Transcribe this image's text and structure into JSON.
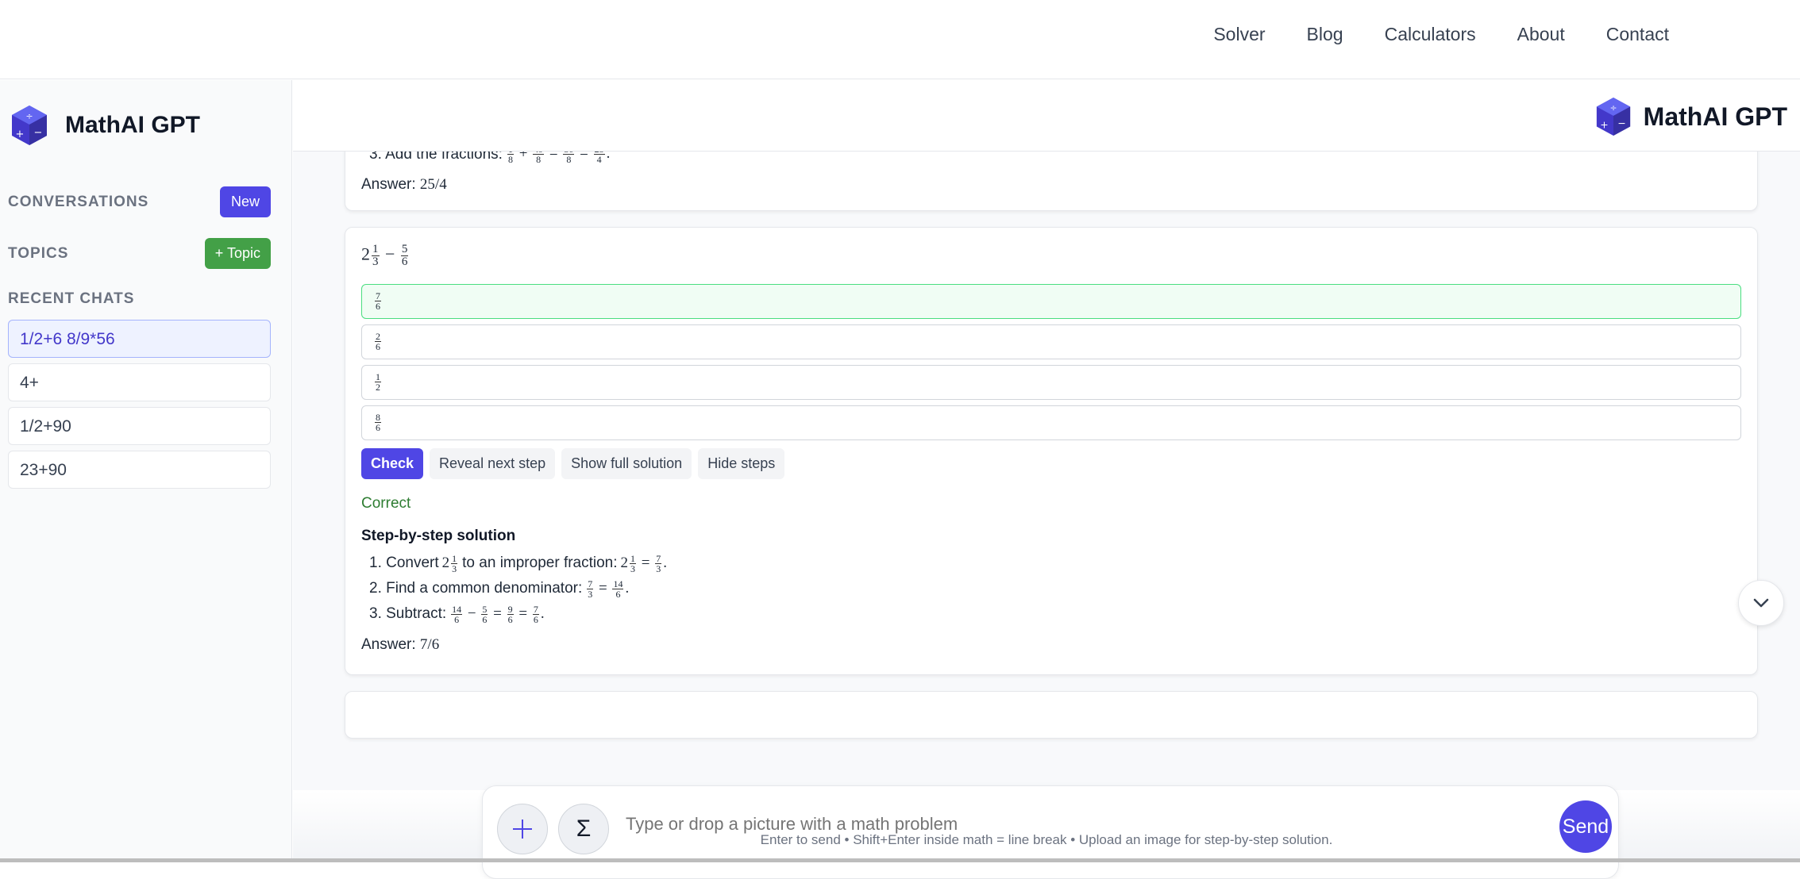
{
  "nav": {
    "links": [
      "Solver",
      "Blog",
      "Calculators",
      "About",
      "Contact"
    ]
  },
  "sidebar": {
    "brand": "MathAI GPT",
    "conversations_label": "CONVERSATIONS",
    "new_label": "New",
    "topics_label": "TOPICS",
    "topic_label": "+ Topic",
    "recent_label": "RECENT CHATS",
    "chats": [
      "1/2+6 8/9*56",
      "4+",
      "1/2+90",
      "23+90"
    ]
  },
  "main": {
    "brand": "MathAI GPT",
    "card1": {
      "step3_text": "3. Add the fractions:",
      "answer_label": "Answer:",
      "answer_value": "25/4"
    },
    "card2": {
      "problem_whole": "2",
      "problem_num": "1",
      "problem_den": "3",
      "problem_op": "−",
      "problem_num2": "5",
      "problem_den2": "6",
      "options": [
        {
          "num": "7",
          "den": "6"
        },
        {
          "num": "2",
          "den": "6"
        },
        {
          "num": "1",
          "den": "2"
        },
        {
          "num": "8",
          "den": "6"
        }
      ],
      "check_label": "Check",
      "reveal_label": "Reveal next step",
      "full_label": "Show full solution",
      "hide_label": "Hide steps",
      "result": "Correct",
      "steps_title": "Step-by-step solution",
      "step1_text": "1. Convert",
      "step1_mid": "to an improper fraction:",
      "step2_text": "2. Find a common denominator:",
      "step3_text": "3. Subtract:",
      "answer_label": "Answer:",
      "answer_value": "7/6"
    },
    "composer": {
      "placeholder": "Type or drop a picture with a math problem",
      "sigma": "Σ",
      "send_label": "Send"
    },
    "hint": "Enter to send • Shift+Enter inside math = line break • Upload an image for step-by-step solution."
  },
  "colors": {
    "accent": "#4f46e5",
    "success": "#43a047",
    "correct_text": "#2e7d32"
  }
}
